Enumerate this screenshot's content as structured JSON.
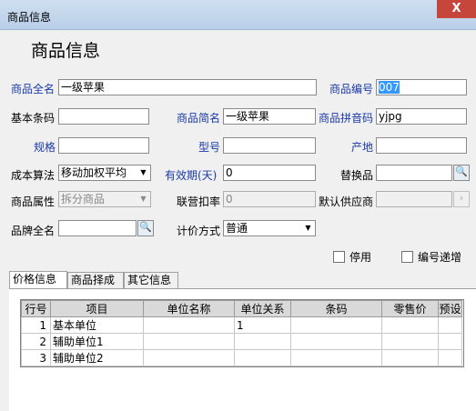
{
  "window": {
    "title": "商品信息",
    "close_glyph": "X"
  },
  "heading": "商品信息",
  "fields": {
    "full_name": {
      "label": "商品全名",
      "value": "一级苹果"
    },
    "code": {
      "label": "商品编号",
      "value": "007"
    },
    "barcode": {
      "label": "基本条码",
      "value": ""
    },
    "short_name": {
      "label": "商品简名",
      "value": "一级苹果"
    },
    "pinyin_code": {
      "label": "商品拼音码",
      "value": "yjpg"
    },
    "spec": {
      "label": "规格",
      "value": ""
    },
    "model": {
      "label": "型号",
      "value": ""
    },
    "origin": {
      "label": "产地",
      "value": ""
    },
    "cost_method": {
      "label": "成本算法",
      "value": "移动加权平均"
    },
    "validity": {
      "label": "有效期(天)",
      "value": "0"
    },
    "substitute": {
      "label": "替换品",
      "value": ""
    },
    "attribute": {
      "label": "商品属性",
      "value": "拆分商品"
    },
    "joint_discount": {
      "label": "联营扣率",
      "value": "0"
    },
    "default_supplier": {
      "label": "默认供应商",
      "value": ""
    },
    "brand_name": {
      "label": "品牌全名",
      "value": ""
    },
    "pricing_method": {
      "label": "计价方式",
      "value": "普通"
    }
  },
  "checkboxes": {
    "disabled": {
      "label": "停用",
      "checked": false
    },
    "auto_increment": {
      "label": "编号递增",
      "checked": false
    }
  },
  "tabs": [
    {
      "label": "价格信息",
      "active": true
    },
    {
      "label": "商品择成",
      "active": false
    },
    {
      "label": "其它信息",
      "active": false
    }
  ],
  "grid": {
    "columns": [
      "行号",
      "项目",
      "单位名称",
      "单位关系",
      "条码",
      "零售价",
      "预设"
    ],
    "rows": [
      {
        "num": "1",
        "item": "基本单位",
        "unit_name": "",
        "relation": "1",
        "barcode": "",
        "retail": "",
        "preset": ""
      },
      {
        "num": "2",
        "item": "辅助单位1",
        "unit_name": "",
        "relation": "",
        "barcode": "",
        "retail": "",
        "preset": ""
      },
      {
        "num": "3",
        "item": "辅助单位2",
        "unit_name": "",
        "relation": "",
        "barcode": "",
        "retail": "",
        "preset": ""
      }
    ]
  },
  "icons": {
    "lookup": "search-icon",
    "dropdown": "chevron-down-icon"
  },
  "colors": {
    "label_blue": "#1a3aa6",
    "titlebar": "#c2d6ec",
    "close_button": "#c7463c",
    "selection": "#3399ff"
  }
}
